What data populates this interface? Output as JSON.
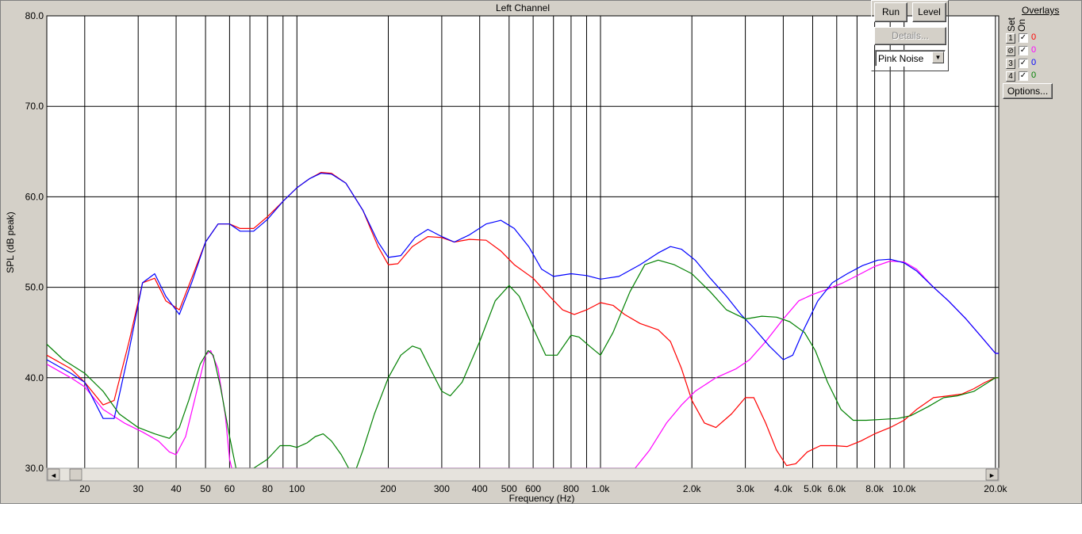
{
  "chart_data": {
    "type": "line",
    "title": "Left Channel",
    "xlabel": "Frequency (Hz)",
    "ylabel": "SPL (dB peak)",
    "x_scale": "log",
    "xlim": [
      15,
      20500
    ],
    "ylim": [
      30,
      80
    ],
    "grid": true,
    "y_ticks": [
      "30.0",
      "40.0",
      "50.0",
      "60.0",
      "70.0",
      "80.0"
    ],
    "y_tick_values": [
      30,
      40,
      50,
      60,
      70,
      80
    ],
    "x_ticks": [
      {
        "value": 20,
        "label": "20"
      },
      {
        "value": 30,
        "label": "30"
      },
      {
        "value": 40,
        "label": "40"
      },
      {
        "value": 50,
        "label": "50"
      },
      {
        "value": 60,
        "label": "60"
      },
      {
        "value": 80,
        "label": "80"
      },
      {
        "value": 100,
        "label": "100"
      },
      {
        "value": 200,
        "label": "200"
      },
      {
        "value": 300,
        "label": "300"
      },
      {
        "value": 400,
        "label": "400"
      },
      {
        "value": 500,
        "label": "500"
      },
      {
        "value": 600,
        "label": "600"
      },
      {
        "value": 800,
        "label": "800"
      },
      {
        "value": 1000,
        "label": "1.0k"
      },
      {
        "value": 2000,
        "label": "2.0k"
      },
      {
        "value": 3000,
        "label": "3.0k"
      },
      {
        "value": 4000,
        "label": "4.0k"
      },
      {
        "value": 5000,
        "label": "5.0k"
      },
      {
        "value": 6000,
        "label": "6.0k"
      },
      {
        "value": 8000,
        "label": "8.0k"
      },
      {
        "value": 10000,
        "label": "10.0k"
      },
      {
        "value": 20000,
        "label": "20.0k"
      }
    ],
    "x_gridlines": [
      20,
      30,
      40,
      50,
      60,
      70,
      80,
      90,
      100,
      200,
      300,
      400,
      500,
      600,
      700,
      800,
      900,
      1000,
      2000,
      3000,
      4000,
      5000,
      6000,
      7000,
      8000,
      9000,
      10000,
      20000
    ],
    "series": [
      {
        "color": "#ff0000",
        "points": [
          [
            15,
            42.5
          ],
          [
            18,
            41.0
          ],
          [
            20,
            39.5
          ],
          [
            23,
            37.0
          ],
          [
            25,
            37.5
          ],
          [
            28,
            44.0
          ],
          [
            31,
            50.5
          ],
          [
            34,
            51.0
          ],
          [
            37,
            48.5
          ],
          [
            41,
            47.5
          ],
          [
            45,
            51.0
          ],
          [
            50,
            55.0
          ],
          [
            55,
            57.0
          ],
          [
            60,
            57.0
          ],
          [
            65,
            56.5
          ],
          [
            72,
            56.5
          ],
          [
            80,
            57.8
          ],
          [
            90,
            59.5
          ],
          [
            100,
            61.0
          ],
          [
            110,
            62.0
          ],
          [
            120,
            62.7
          ],
          [
            130,
            62.6
          ],
          [
            145,
            61.5
          ],
          [
            165,
            58.5
          ],
          [
            185,
            54.5
          ],
          [
            200,
            52.5
          ],
          [
            215,
            52.6
          ],
          [
            240,
            54.5
          ],
          [
            270,
            55.6
          ],
          [
            300,
            55.5
          ],
          [
            330,
            55.0
          ],
          [
            370,
            55.3
          ],
          [
            420,
            55.2
          ],
          [
            470,
            54.0
          ],
          [
            520,
            52.5
          ],
          [
            600,
            51.0
          ],
          [
            680,
            49.0
          ],
          [
            750,
            47.5
          ],
          [
            820,
            47.0
          ],
          [
            900,
            47.5
          ],
          [
            1000,
            48.3
          ],
          [
            1100,
            48.0
          ],
          [
            1200,
            47.0
          ],
          [
            1350,
            46.0
          ],
          [
            1550,
            45.3
          ],
          [
            1700,
            44.0
          ],
          [
            1850,
            41.0
          ],
          [
            2000,
            37.5
          ],
          [
            2200,
            35.0
          ],
          [
            2400,
            34.5
          ],
          [
            2700,
            36.0
          ],
          [
            3000,
            37.8
          ],
          [
            3200,
            37.8
          ],
          [
            3500,
            35.0
          ],
          [
            3800,
            32.0
          ],
          [
            4100,
            30.3
          ],
          [
            4400,
            30.5
          ],
          [
            4800,
            31.8
          ],
          [
            5300,
            32.5
          ],
          [
            5900,
            32.5
          ],
          [
            6500,
            32.4
          ],
          [
            7200,
            33.0
          ],
          [
            8000,
            33.8
          ],
          [
            9000,
            34.5
          ],
          [
            10000,
            35.3
          ],
          [
            11000,
            36.5
          ],
          [
            12500,
            37.8
          ],
          [
            14000,
            38.0
          ],
          [
            15500,
            38.2
          ],
          [
            17000,
            38.8
          ],
          [
            18500,
            39.5
          ],
          [
            20000,
            40.0
          ],
          [
            20500,
            40.0
          ]
        ]
      },
      {
        "color": "#ff00ff",
        "points": [
          [
            15,
            41.5
          ],
          [
            18,
            40.0
          ],
          [
            20,
            39.0
          ],
          [
            23,
            36.5
          ],
          [
            27,
            35.0
          ],
          [
            31,
            34.0
          ],
          [
            35,
            33.0
          ],
          [
            38,
            31.8
          ],
          [
            40,
            31.5
          ],
          [
            43,
            33.5
          ],
          [
            46,
            37.5
          ],
          [
            50,
            42.5
          ],
          [
            52,
            43.0
          ],
          [
            55,
            41.0
          ],
          [
            58,
            36.0
          ],
          [
            60,
            31.0
          ],
          [
            61,
            30.0
          ],
          [
            1300,
            30.0
          ],
          [
            1450,
            32.0
          ],
          [
            1650,
            35.0
          ],
          [
            1850,
            37.0
          ],
          [
            2050,
            38.5
          ],
          [
            2400,
            40.0
          ],
          [
            2800,
            41.0
          ],
          [
            3100,
            42.0
          ],
          [
            3500,
            44.0
          ],
          [
            4000,
            46.5
          ],
          [
            4500,
            48.5
          ],
          [
            5000,
            49.2
          ],
          [
            5600,
            49.8
          ],
          [
            6300,
            50.5
          ],
          [
            7200,
            51.5
          ],
          [
            8000,
            52.3
          ],
          [
            9000,
            52.9
          ],
          [
            10000,
            52.8
          ],
          [
            11000,
            52.0
          ],
          [
            12500,
            50.0
          ],
          [
            14000,
            48.5
          ],
          [
            16000,
            46.5
          ],
          [
            18000,
            44.5
          ],
          [
            20000,
            42.7
          ],
          [
            20500,
            42.7
          ]
        ]
      },
      {
        "color": "#0000ff",
        "points": [
          [
            15,
            42.0
          ],
          [
            18,
            40.5
          ],
          [
            20,
            39.5
          ],
          [
            23,
            35.5
          ],
          [
            25,
            35.5
          ],
          [
            28,
            43.0
          ],
          [
            31,
            50.5
          ],
          [
            34,
            51.5
          ],
          [
            37,
            49.0
          ],
          [
            41,
            47.0
          ],
          [
            45,
            50.5
          ],
          [
            50,
            55.0
          ],
          [
            55,
            57.0
          ],
          [
            60,
            57.0
          ],
          [
            65,
            56.2
          ],
          [
            72,
            56.2
          ],
          [
            80,
            57.5
          ],
          [
            90,
            59.5
          ],
          [
            100,
            61.0
          ],
          [
            110,
            62.0
          ],
          [
            120,
            62.6
          ],
          [
            130,
            62.5
          ],
          [
            145,
            61.5
          ],
          [
            165,
            58.5
          ],
          [
            185,
            55.0
          ],
          [
            200,
            53.3
          ],
          [
            220,
            53.5
          ],
          [
            245,
            55.5
          ],
          [
            270,
            56.4
          ],
          [
            300,
            55.6
          ],
          [
            330,
            55.0
          ],
          [
            370,
            55.8
          ],
          [
            420,
            57.0
          ],
          [
            470,
            57.4
          ],
          [
            520,
            56.5
          ],
          [
            580,
            54.5
          ],
          [
            640,
            52.0
          ],
          [
            700,
            51.2
          ],
          [
            800,
            51.5
          ],
          [
            900,
            51.3
          ],
          [
            1000,
            50.9
          ],
          [
            1150,
            51.2
          ],
          [
            1350,
            52.5
          ],
          [
            1550,
            53.8
          ],
          [
            1700,
            54.5
          ],
          [
            1850,
            54.2
          ],
          [
            2050,
            53.0
          ],
          [
            2300,
            51.0
          ],
          [
            2600,
            49.0
          ],
          [
            2900,
            47.0
          ],
          [
            3200,
            45.5
          ],
          [
            3600,
            43.5
          ],
          [
            4000,
            42.0
          ],
          [
            4300,
            42.5
          ],
          [
            4700,
            45.5
          ],
          [
            5200,
            48.5
          ],
          [
            5800,
            50.5
          ],
          [
            6500,
            51.5
          ],
          [
            7300,
            52.4
          ],
          [
            8200,
            53.0
          ],
          [
            9000,
            53.1
          ],
          [
            10000,
            52.7
          ],
          [
            11000,
            51.8
          ],
          [
            12500,
            50.0
          ],
          [
            14000,
            48.5
          ],
          [
            16000,
            46.5
          ],
          [
            18000,
            44.5
          ],
          [
            20000,
            42.7
          ],
          [
            20500,
            42.7
          ]
        ]
      },
      {
        "color": "#008000",
        "points": [
          [
            15,
            43.7
          ],
          [
            17,
            42.0
          ],
          [
            20,
            40.5
          ],
          [
            23,
            38.5
          ],
          [
            26,
            36.0
          ],
          [
            30,
            34.5
          ],
          [
            34,
            33.8
          ],
          [
            38,
            33.3
          ],
          [
            41,
            34.5
          ],
          [
            44,
            37.5
          ],
          [
            48,
            41.5
          ],
          [
            51,
            43.0
          ],
          [
            53,
            42.5
          ],
          [
            56,
            39.0
          ],
          [
            60,
            33.5
          ],
          [
            63,
            30.0
          ],
          [
            72,
            30.0
          ],
          [
            80,
            31.0
          ],
          [
            88,
            32.5
          ],
          [
            95,
            32.5
          ],
          [
            100,
            32.3
          ],
          [
            108,
            32.8
          ],
          [
            115,
            33.5
          ],
          [
            122,
            33.8
          ],
          [
            130,
            33.0
          ],
          [
            140,
            31.5
          ],
          [
            148,
            30.0
          ],
          [
            157,
            30.0
          ],
          [
            165,
            32.0
          ],
          [
            180,
            36.0
          ],
          [
            200,
            40.0
          ],
          [
            220,
            42.5
          ],
          [
            240,
            43.5
          ],
          [
            255,
            43.2
          ],
          [
            275,
            41.0
          ],
          [
            300,
            38.5
          ],
          [
            320,
            38.0
          ],
          [
            350,
            39.5
          ],
          [
            400,
            44.0
          ],
          [
            450,
            48.5
          ],
          [
            500,
            50.2
          ],
          [
            540,
            49.0
          ],
          [
            600,
            45.5
          ],
          [
            660,
            42.5
          ],
          [
            720,
            42.5
          ],
          [
            800,
            44.7
          ],
          [
            850,
            44.5
          ],
          [
            920,
            43.5
          ],
          [
            1000,
            42.5
          ],
          [
            1100,
            45.0
          ],
          [
            1250,
            49.5
          ],
          [
            1400,
            52.5
          ],
          [
            1550,
            53.0
          ],
          [
            1750,
            52.5
          ],
          [
            2000,
            51.5
          ],
          [
            2300,
            49.5
          ],
          [
            2600,
            47.5
          ],
          [
            3000,
            46.5
          ],
          [
            3400,
            46.8
          ],
          [
            3800,
            46.7
          ],
          [
            4200,
            46.2
          ],
          [
            4700,
            45.0
          ],
          [
            5100,
            43.0
          ],
          [
            5600,
            39.5
          ],
          [
            6200,
            36.5
          ],
          [
            6800,
            35.3
          ],
          [
            7500,
            35.3
          ],
          [
            8500,
            35.4
          ],
          [
            9500,
            35.5
          ],
          [
            10500,
            35.8
          ],
          [
            12000,
            36.8
          ],
          [
            13500,
            37.8
          ],
          [
            15000,
            38.0
          ],
          [
            17000,
            38.5
          ],
          [
            20000,
            40.0
          ],
          [
            20500,
            40.0
          ]
        ]
      }
    ]
  },
  "controls": {
    "run_label": "Run",
    "level_label": "Level",
    "details_label": "Details...",
    "signal_value": "Pink Noise",
    "options_label": "Options..."
  },
  "overlays": {
    "title": "Overlays",
    "set_header": "Set",
    "on_header": "On",
    "rows": [
      {
        "num": "1",
        "value": "0",
        "color": "#ff0000"
      },
      {
        "num": "⊘",
        "value": "0",
        "color": "#ff00ff"
      },
      {
        "num": "3",
        "value": "0",
        "color": "#0000ff"
      },
      {
        "num": "4",
        "value": "0",
        "color": "#008000"
      }
    ],
    "check_mark": "✓"
  },
  "scrollbar": {
    "left_arrow": "◄",
    "right_arrow": "►"
  }
}
